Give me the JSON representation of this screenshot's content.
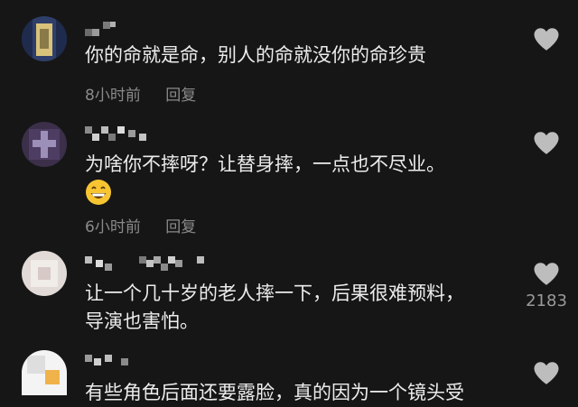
{
  "comments": [
    {
      "text": "你的命就是命，别人的命就没你的命珍贵",
      "time": "8小时前",
      "reply": "回复",
      "likes": ""
    },
    {
      "text": "为啥你不摔呀？让替身摔，一点也不尽业。",
      "emoji": "grinning-face",
      "time": "6小时前",
      "reply": "回复",
      "likes": ""
    },
    {
      "text": "让一个几十岁的老人摔一下，后果很难预料，\n导演也害怕。",
      "time": "",
      "reply": "",
      "likes": "2183"
    },
    {
      "text": "有些角色后面还要露脸，真的因为一个镜头受",
      "time": "",
      "reply": "",
      "likes": ""
    }
  ],
  "icons": {
    "like": "heart-icon"
  },
  "colors": {
    "background": "#161616",
    "text": "#ececec",
    "meta": "#8a8a8a",
    "heart": "#bdbdbd"
  }
}
